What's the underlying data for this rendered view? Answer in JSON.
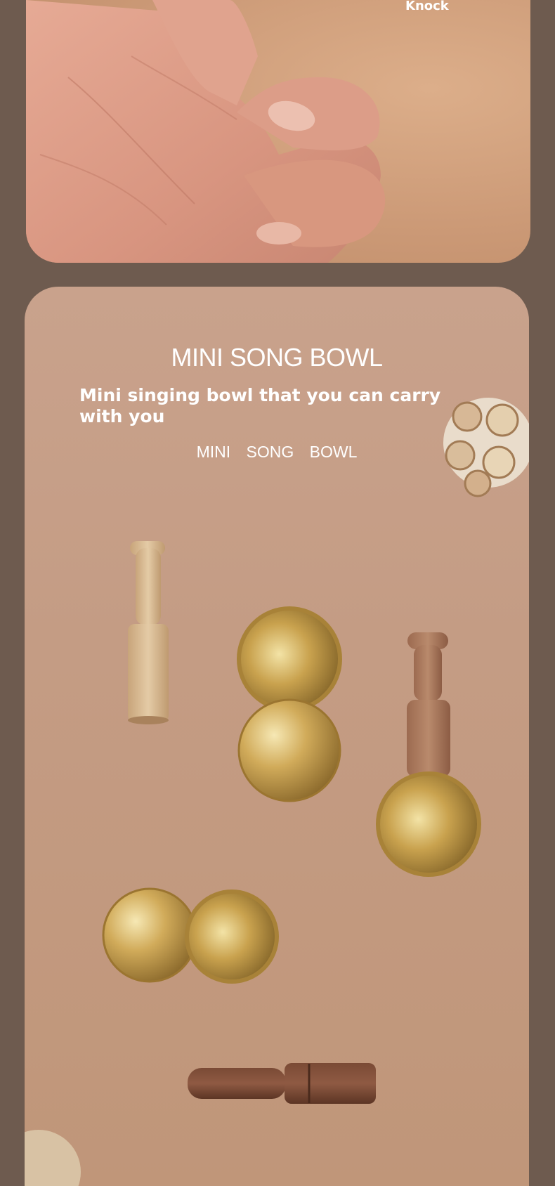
{
  "top_panel": {
    "label": "Knock",
    "image": "hand-knocking-photo"
  },
  "bottom_panel": {
    "title": "MINI SONG BOWL",
    "subtitle": "Mini singing bowl that you can carry with you",
    "words": [
      "MINI",
      "SONG",
      "BOWL"
    ],
    "image": "mini-singing-bowls-product-photo"
  },
  "colors": {
    "page_bg": "#6e5b4f",
    "panel_bg": "#c49c84",
    "brass": "#c9a24e",
    "wood_light": "#d8bb95",
    "wood_dark": "#6b4030"
  }
}
